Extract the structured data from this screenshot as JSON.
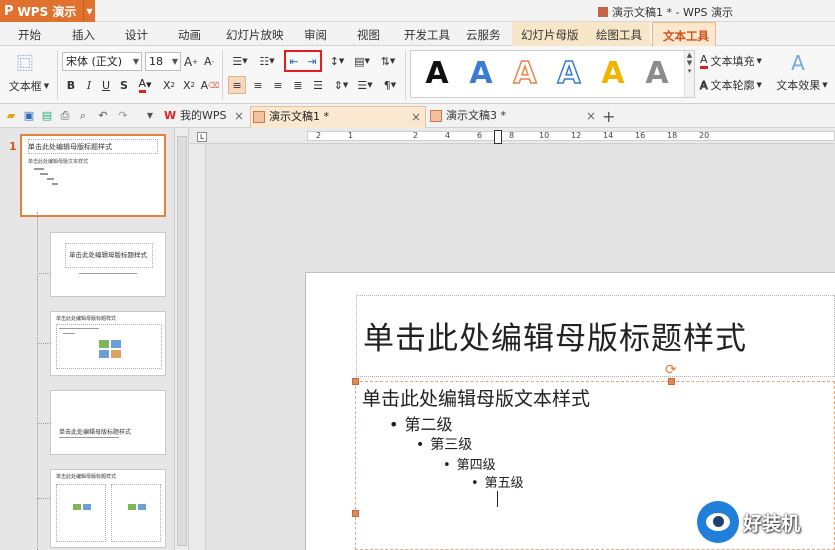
{
  "app": {
    "name": "WPS 演示",
    "window_title": "演示文稿1 * - WPS 演示"
  },
  "ribbon_tabs": [
    "开始",
    "插入",
    "设计",
    "动画",
    "幻灯片放映",
    "审阅",
    "视图",
    "开发工具",
    "云服务",
    "幻灯片母版",
    "绘图工具",
    "文本工具"
  ],
  "ribbon": {
    "textbox_label": "文本框",
    "font_name": "宋体 (正文)",
    "font_size": "18",
    "text_fill_label": "文本填充",
    "text_outline_label": "文本轮廓",
    "text_effect_label": "文本效果",
    "style_glyph": "A",
    "colors": {
      "accent_orange": "#e0712e",
      "style_blue": "#3a7bd5",
      "style_orange": "#e7844c",
      "style_gold": "#f1b400",
      "style_gray": "#8c8c8c",
      "highlight_red": "#e02020"
    }
  },
  "doc_tabs": [
    {
      "label": "我的WPS",
      "active": false
    },
    {
      "label": "演示文稿1 *",
      "active": true
    },
    {
      "label": "演示文稿3 *",
      "active": false
    }
  ],
  "thumbnails": {
    "slide_number": "1",
    "master_title": "单击此处编辑母版标题样式",
    "layout_title": "单击此处编辑母版标题样式",
    "small_text": "单击此处编辑母版文本样式"
  },
  "ruler": {
    "numbers": [
      "2",
      "1",
      "2",
      "4",
      "6",
      "8",
      "10",
      "12",
      "14",
      "16",
      "18",
      "20"
    ]
  },
  "slide": {
    "title": "单击此处编辑母版标题样式",
    "levels": [
      "单击此处编辑母版文本样式",
      "第二级",
      "第三级",
      "第四级",
      "第五级"
    ],
    "bullet": "•"
  },
  "watermark": {
    "text": "好装机"
  }
}
